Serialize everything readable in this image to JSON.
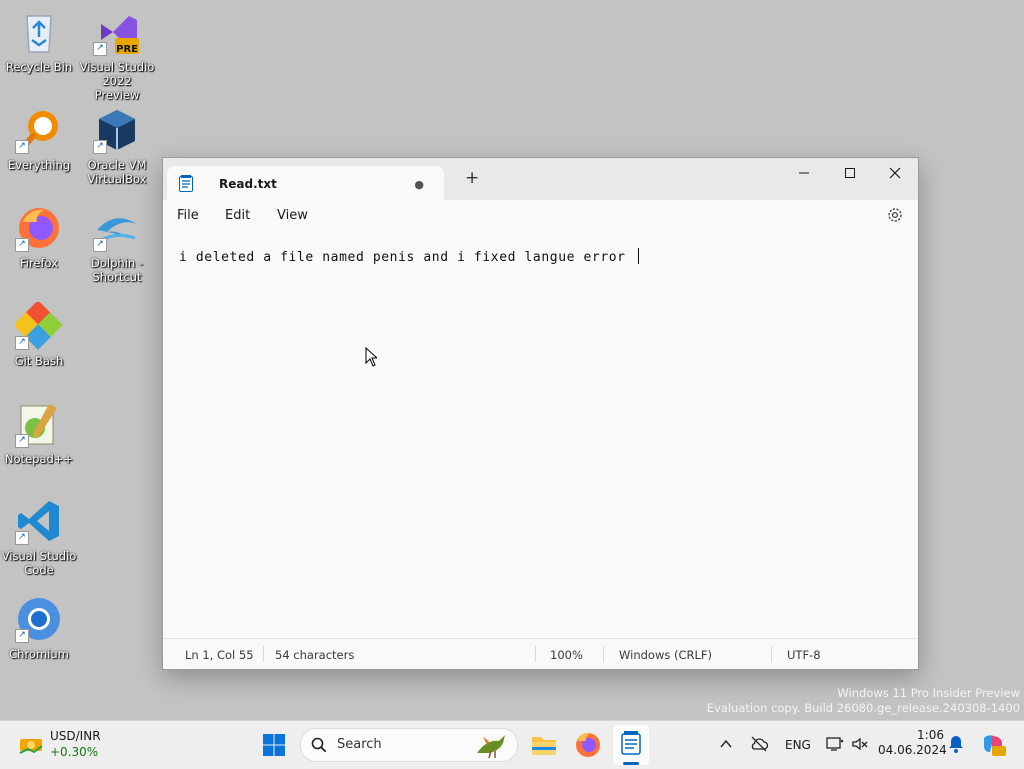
{
  "desktop": {
    "icons": [
      {
        "label_line1": "Recycle Bin",
        "label_line2": "",
        "icon": "recycle-bin-icon"
      },
      {
        "label_line1": "Visual Studio",
        "label_line2": "2022 Preview",
        "icon": "visual-studio-preview-icon",
        "badge": "PRE"
      },
      {
        "label_line1": "Everything",
        "label_line2": "",
        "icon": "everything-search-icon"
      },
      {
        "label_line1": "Oracle VM",
        "label_line2": "VirtualBox",
        "icon": "virtualbox-icon"
      },
      {
        "label_line1": "Firefox",
        "label_line2": "",
        "icon": "firefox-icon"
      },
      {
        "label_line1": "Dolphin -",
        "label_line2": "Shortcut",
        "icon": "dolphin-icon"
      },
      {
        "label_line1": "Git Bash",
        "label_line2": "",
        "icon": "git-bash-icon"
      },
      {
        "label_line1": "Notepad++",
        "label_line2": "",
        "icon": "notepadpp-icon"
      },
      {
        "label_line1": "Visual Studio",
        "label_line2": "Code",
        "icon": "vscode-icon"
      },
      {
        "label_line1": "Chromium",
        "label_line2": "",
        "icon": "chromium-icon"
      }
    ],
    "watermark_line1": "Windows 11 Pro Insider Preview",
    "watermark_line2": "Evaluation copy. Build 26080.ge_release.240308-1400"
  },
  "notepad": {
    "tab_title": "Read.txt",
    "unsaved_marker": "●",
    "new_tab": "+",
    "menu": {
      "file": "File",
      "edit": "Edit",
      "view": "View"
    },
    "content": "i deleted a file named penis and i fixed langue error ",
    "status": {
      "position": "Ln 1, Col 55",
      "characters": "54 characters",
      "zoom": "100%",
      "line_ending": "Windows (CRLF)",
      "encoding": "UTF-8"
    }
  },
  "taskbar": {
    "widget_title": "USD/INR",
    "widget_value": "+0.30%",
    "search_placeholder": "Search",
    "language": "ENG",
    "time": "1:06",
    "date": "04.06.2024"
  },
  "colors": {
    "desktop": "#c3c3c3",
    "win_blue": "#0067c0",
    "widget_green": "#107c10"
  }
}
